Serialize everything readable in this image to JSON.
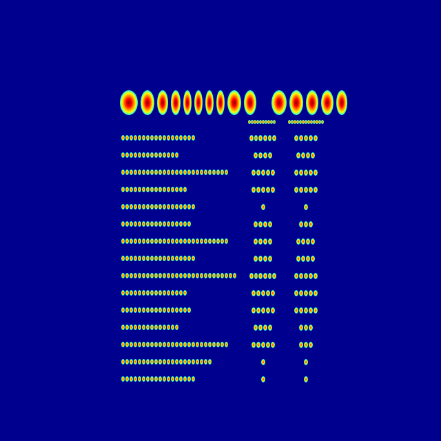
{
  "heading": "",
  "columns": [
    "",
    ""
  ],
  "rows": [
    {
      "label": "",
      "v1": "",
      "v2": ""
    },
    {
      "label": "",
      "v1": "",
      "v2": ""
    },
    {
      "label": "",
      "v1": "",
      "v2": ""
    },
    {
      "label": "",
      "v1": "",
      "v2": ""
    },
    {
      "label": "",
      "v1": "",
      "v2": ""
    },
    {
      "label": "",
      "v1": "",
      "v2": ""
    },
    {
      "label": "",
      "v1": "",
      "v2": ""
    },
    {
      "label": "",
      "v1": "",
      "v2": ""
    },
    {
      "label": "",
      "v1": "",
      "v2": ""
    },
    {
      "label": "",
      "v1": "",
      "v2": ""
    },
    {
      "label": "",
      "v1": "",
      "v2": ""
    },
    {
      "label": "",
      "v1": "",
      "v2": ""
    },
    {
      "label": "",
      "v1": "",
      "v2": ""
    },
    {
      "label": "",
      "v1": "",
      "v2": ""
    },
    {
      "label": "",
      "v1": "",
      "v2": ""
    }
  ],
  "colors": {
    "background": "#00008f",
    "hot": "#ff0000",
    "warm": "#ffff00",
    "cool": "#00ffff"
  }
}
